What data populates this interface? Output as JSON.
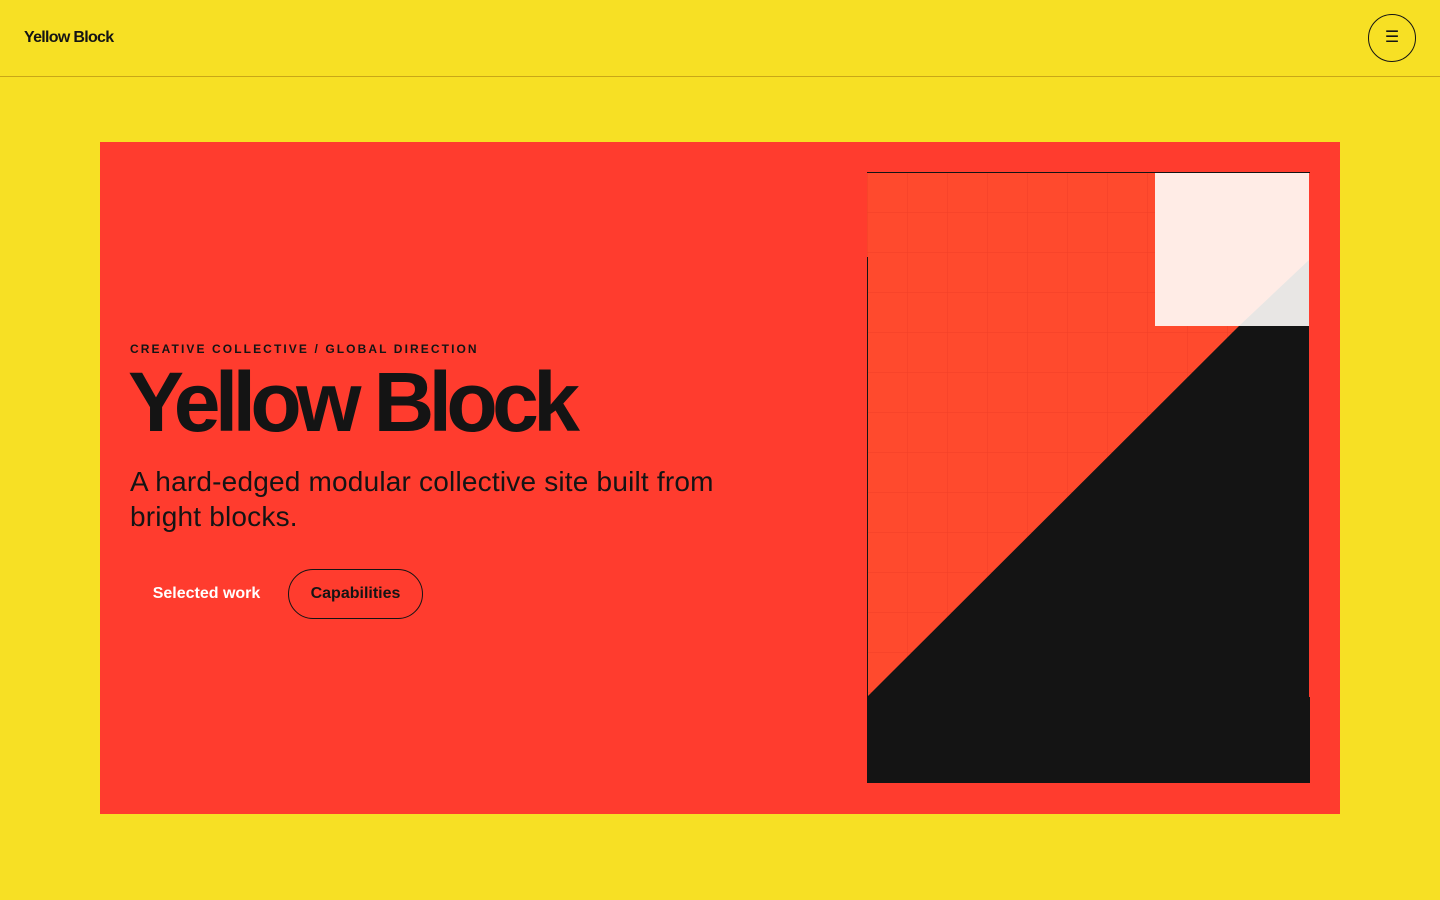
{
  "header": {
    "logo": "Yellow Block",
    "menu_icon": "hamburger-icon",
    "menu_glyph": "☰"
  },
  "hero": {
    "eyebrow": "CREATIVE COLLECTIVE / GLOBAL DIRECTION",
    "title": "Yellow Block",
    "subtitle": "A hard-edged modular collective site built from bright blocks.",
    "buttons": {
      "selected_work": "Selected work",
      "capabilities": "Capabilities"
    }
  },
  "colors": {
    "page_background": "#f7e024",
    "hero_background": "#ff3c2e",
    "art_red": "#ff4a2d",
    "ink": "#141414",
    "art_pale": "#ffece6",
    "art_grey": "#e8e6e4",
    "button_text_light": "#ffffff"
  }
}
